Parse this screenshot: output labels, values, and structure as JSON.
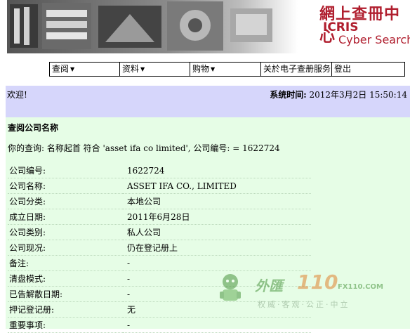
{
  "banner": {
    "title_cn": "網上查冊中心",
    "title_en1": "ICRIS",
    "title_en2": "Cyber Search Centre"
  },
  "menu": [
    {
      "label": "查阅",
      "dropdown": true
    },
    {
      "label": "资料",
      "dropdown": true
    },
    {
      "label": "购物",
      "dropdown": true
    },
    {
      "label": "关於电子查册服务",
      "dropdown": false
    },
    {
      "label": "登出",
      "dropdown": false
    }
  ],
  "menu_caret": "▼",
  "welcome": "欢迎!",
  "system_time_label": "系统时间:",
  "system_time_value": "2012年3月2日 15:50:14",
  "section_title": "查阅公司名称",
  "query_text": "你的查询: 名称起首 符合 'asset ifa co limited', 公司编号: = 1622724",
  "rows": [
    {
      "label": "公司编号:",
      "value": "1622724"
    },
    {
      "label": "公司名称:",
      "value": "ASSET IFA CO., LIMITED"
    },
    {
      "label": "公司分类:",
      "value": "本地公司"
    },
    {
      "label": "成立日期:",
      "value": "2011年6月28日"
    },
    {
      "label": "公司类别:",
      "value": "私人公司"
    },
    {
      "label": "公司现况:",
      "value": "仍在登记册上"
    },
    {
      "label": "备注:",
      "value": "-"
    },
    {
      "label": "清盘模式:",
      "value": "-"
    },
    {
      "label": "已告解散日期:",
      "value": "-"
    },
    {
      "label": "押记登记册:",
      "value": "无"
    },
    {
      "label": "重要事项:",
      "value": "-"
    }
  ],
  "watermark": {
    "cn": "外匯",
    "num": "110",
    "domain": "FX110.COM",
    "slogan": "权威·客观·公正·中立"
  },
  "colors": {
    "welcome_bg": "#d6d6fb",
    "main_bg": "#e6fde6",
    "banner_red": "#b01e2e"
  }
}
